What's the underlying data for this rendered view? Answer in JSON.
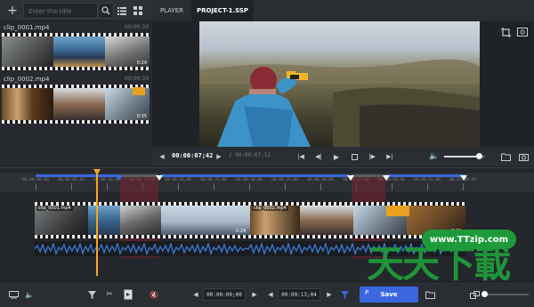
{
  "library": {
    "search_placeholder": "Enter the title",
    "clips": [
      {
        "name": "clip_0001.mp4",
        "duration": "00:00:33"
      },
      {
        "name": "clip_0002.mp4",
        "duration": "00:00:33"
      }
    ],
    "clip1_thumb_time": "0:29",
    "clip2_thumb_time": "0:35"
  },
  "header": {
    "tabs": [
      {
        "label": "PLAYER"
      },
      {
        "label": "PROJECT-1.SSP"
      }
    ]
  },
  "player": {
    "current_time": "00:00:07;42",
    "total_time": "/ 00:00:07;12",
    "volume": 0.85
  },
  "timeline": {
    "ruler_ticks": [
      "00:00:00;00",
      "00:00:05;00",
      "00:00:10;00",
      "00:00:15;00",
      "00:00:20;00",
      "00:00:25;00",
      "00:00:30;00",
      "00:00:35;00",
      "00:00:40;00",
      "00:00:45;00",
      "00:00:50;00",
      "00:00:55;00",
      "00:01:00;00"
    ],
    "track_clips": [
      {
        "name": "clip_0001.mp4",
        "end_time": "0:29"
      },
      {
        "name": "clip_0002.mp4",
        "end_time": "0:29"
      }
    ]
  },
  "bottom": {
    "in_time": "00:00:00;00",
    "out_time": "00:00:13;04",
    "save_label": "Save",
    "save_icon": "P"
  },
  "watermark": {
    "url": "www.TTzip.com",
    "chars": "天天下載"
  },
  "colors": {
    "accent_blue": "#3a67e0",
    "playhead": "#f5a623",
    "marker_red": "#7a2230",
    "waveform": "#3a7bd5"
  }
}
